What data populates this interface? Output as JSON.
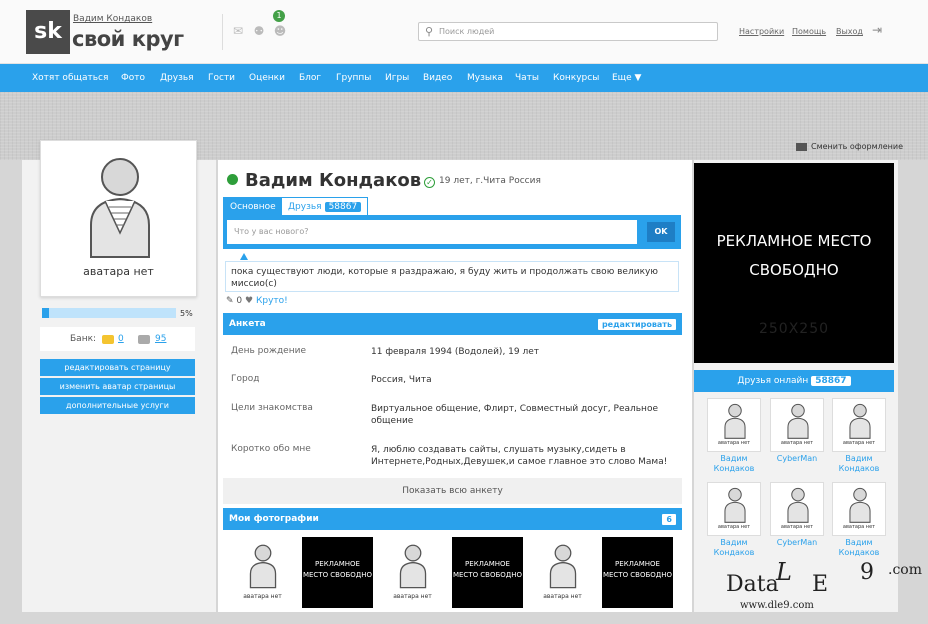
{
  "header": {
    "logo_short": "sk",
    "logo_name": "свой круг",
    "user_link": "Вадим Кондаков",
    "notif_count": "1",
    "search_placeholder": "Поиск людей",
    "links": [
      "Настройки",
      "Помощь",
      "Выход"
    ],
    "exit_icon": "exit-icon"
  },
  "nav": [
    "Хотят общаться",
    "Фото",
    "Друзья",
    "Гости",
    "Оценки",
    "Блог",
    "Группы",
    "Игры",
    "Видео",
    "Музыка",
    "Чаты",
    "Конкурсы",
    "Еще ▼"
  ],
  "change_design": "Сменить оформление",
  "left": {
    "avatar_label": "аватара нет",
    "progress_percent": 5,
    "progress_text": "5%",
    "bank_label": "Банк:",
    "bank_gold": "0",
    "bank_silver": "95",
    "buttons": [
      "редактировать страницу",
      "изменить аватар страницы",
      "дополнительные услуги"
    ]
  },
  "profile": {
    "name": "Вадим Кондаков",
    "age_city": "19 лет, г.Чита Россия",
    "tabs": {
      "main": "Основное",
      "friends": "Друзья",
      "friends_count": "58867"
    },
    "post_placeholder": "Что у вас нового?",
    "ok": "OK",
    "status": "пока существуют люди, которые я раздражаю, я буду жить и продолжать свою великую миссио(с)",
    "likes_count": "0",
    "cool_label": "Круто!",
    "anketa_title": "Анкета",
    "edit_label": "редактировать",
    "rows": [
      {
        "label": "День рождение",
        "value": "11 февраля 1994 (Водолей), 19 лет"
      },
      {
        "label": "Город",
        "value": "Россия, Чита"
      },
      {
        "label": "Цели знакомства",
        "value": "Виртуальное общение, Флирт, Совместный досуг, Реальное общение"
      },
      {
        "label": "Коротко обо мне",
        "value": "Я, люблю создавать сайты, слушать музыку,сидеть в Интернете,Родных,Девушек,и самое главное это слово Мама!"
      }
    ],
    "show_all": "Показать всю анкету",
    "photos_title": "Мои фотографии",
    "photos_count": "6",
    "photo_ad_text": "РЕКЛАМНОЕ МЕСТО СВОБОДНО",
    "photo_av_text": "аватара нет"
  },
  "right": {
    "ad_text_1": "РЕКЛАМНОЕ МЕСТО",
    "ad_text_2": "СВОБОДНО",
    "ad_size": "250X250",
    "friends_online": "Друзья онлайн",
    "friends_count": "58867",
    "friends": [
      {
        "name": "Вадим Кондаков",
        "pic": "аватара нет"
      },
      {
        "name": "CyberMan",
        "pic": "аватара нет"
      },
      {
        "name": "Вадим Кондаков",
        "pic": "аватара нет"
      },
      {
        "name": "Вадим Кондаков",
        "pic": "аватара нет"
      },
      {
        "name": "CyberMan",
        "pic": "аватара нет"
      },
      {
        "name": "Вадим Кондаков",
        "pic": "аватара нет"
      }
    ]
  },
  "watermark": {
    "a": "Data",
    "b": "L",
    "c": "E",
    "d": "9",
    "e": ".com",
    "f": "www.dle9.com"
  },
  "colors": {
    "accent": "#2aa1eb",
    "online": "#2e9e3a",
    "ad_bg": "#000000"
  }
}
